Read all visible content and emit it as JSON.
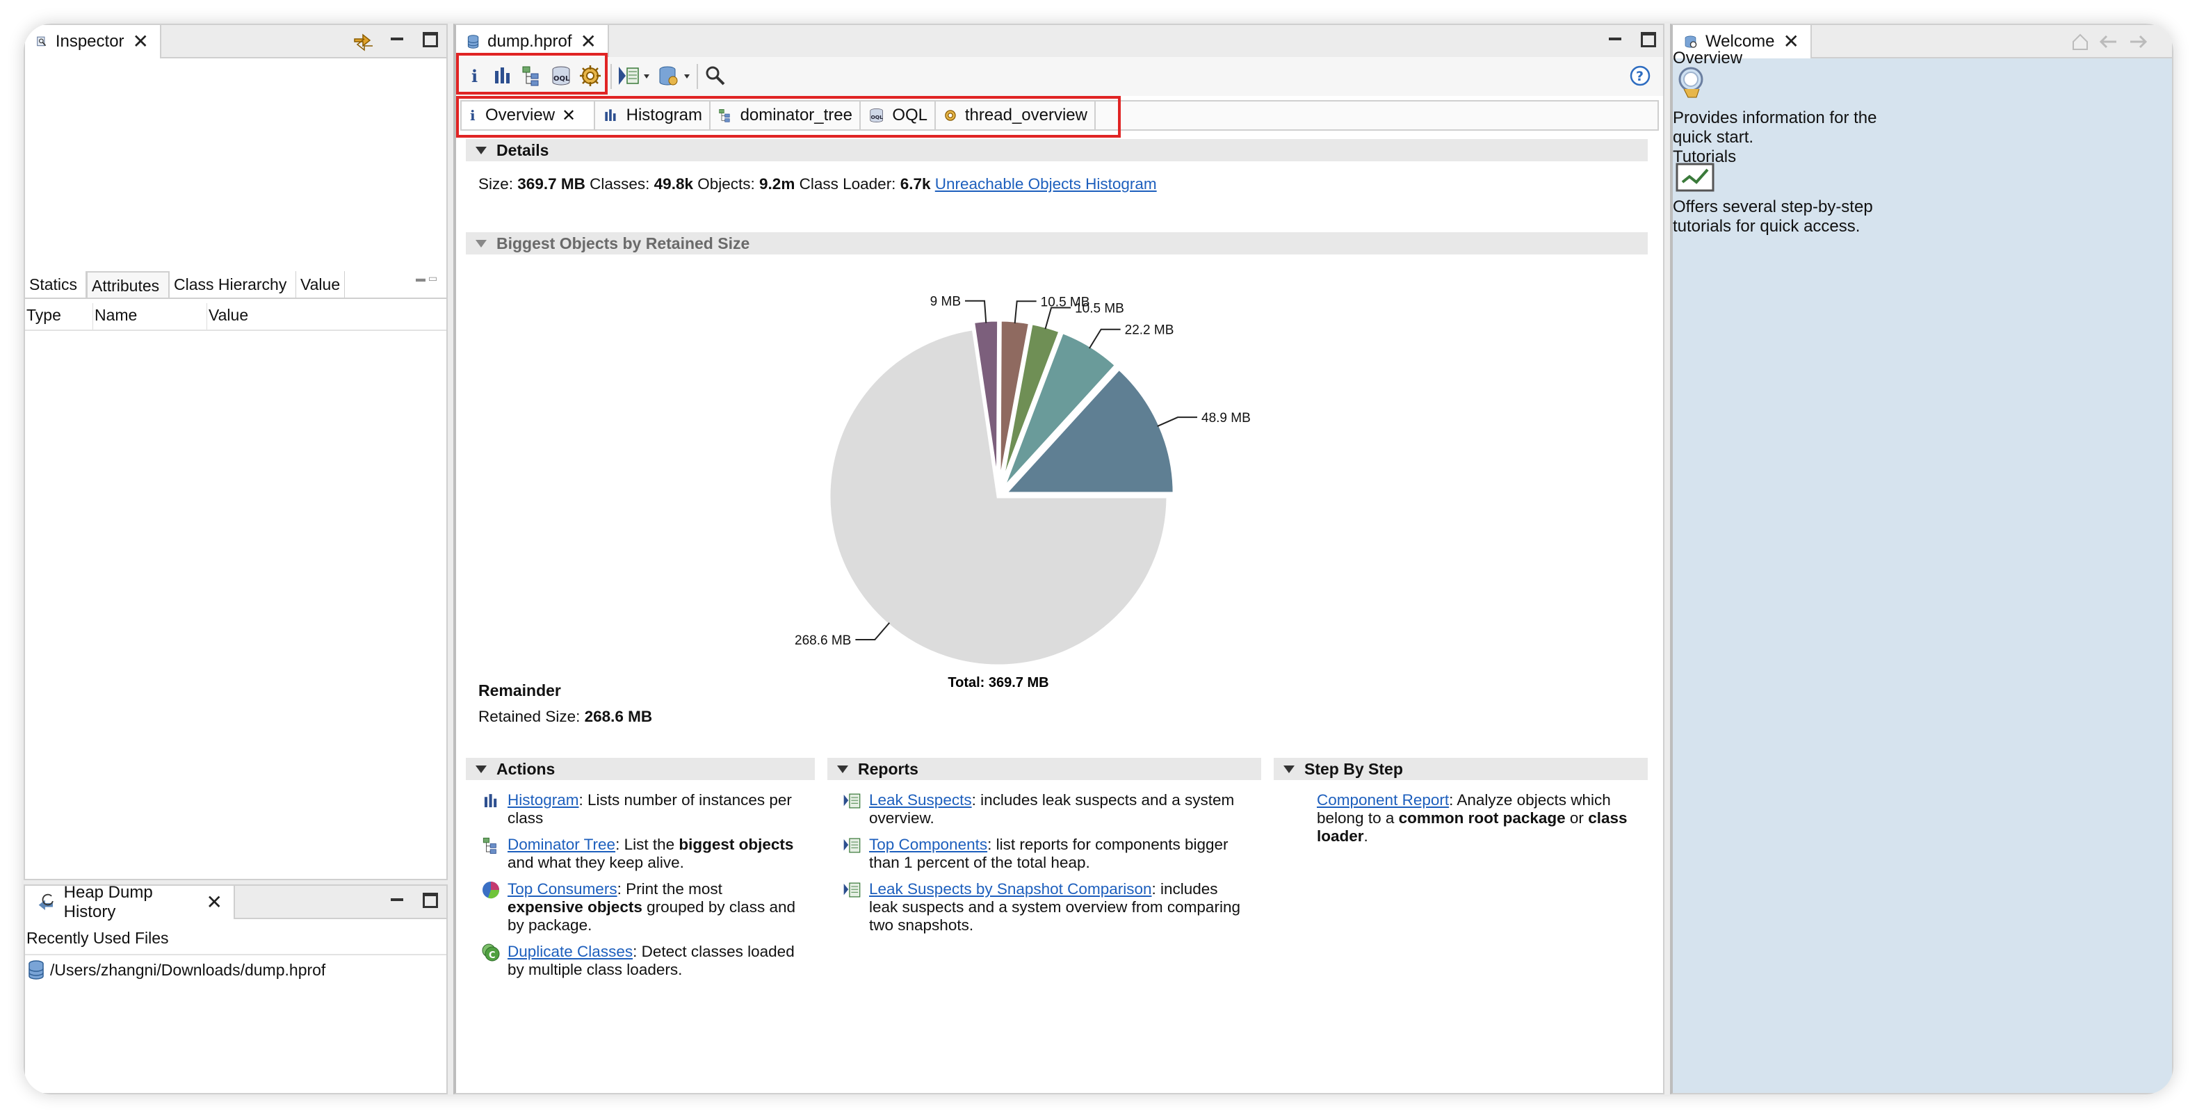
{
  "inspector": {
    "title": "Inspector",
    "subtabs": [
      "Statics",
      "Attributes",
      "Class Hierarchy",
      "Value"
    ],
    "columns": [
      "Type",
      "Name",
      "Value"
    ]
  },
  "history": {
    "title": "Heap Dump History",
    "section": "Recently Used Files",
    "file": "/Users/zhangni/Downloads/dump.hprof"
  },
  "editor": {
    "tab_title": "dump.hprof",
    "inner_tabs": [
      "Overview",
      "Histogram",
      "dominator_tree",
      "OQL",
      "thread_overview"
    ]
  },
  "details": {
    "heading": "Details",
    "size_label": "Size:",
    "size_value": "369.7 MB",
    "classes_label": "Classes:",
    "classes_value": "49.8k",
    "objects_label": "Objects:",
    "objects_value": "9.2m",
    "loader_label": "Class Loader:",
    "loader_value": "6.7k",
    "unreachable_link": "Unreachable Objects Histogram"
  },
  "biggest": {
    "heading": "Biggest Objects by Retained Size",
    "total": "Total: 369.7 MB",
    "remainder_title": "Remainder",
    "retained_label": "Retained Size:",
    "retained_value": "268.6 MB"
  },
  "chart_data": {
    "type": "pie",
    "unit": "MB",
    "slices": [
      {
        "label": "48.9 MB",
        "value": 48.9,
        "color": "#5f7f93"
      },
      {
        "label": "22.2 MB",
        "value": 22.2,
        "color": "#6a9b9a"
      },
      {
        "label": "10.5 MB",
        "value": 10.5,
        "color": "#6f8f55"
      },
      {
        "label": "10.5 MB",
        "value": 10.5,
        "color": "#8f6a60"
      },
      {
        "label": "9 MB",
        "value": 9.0,
        "color": "#7c5f7c"
      },
      {
        "label": "268.6 MB",
        "value": 268.6,
        "color": "#dcdcdc"
      }
    ],
    "total": 369.7
  },
  "actions": {
    "heading": "Actions",
    "histogram_link": "Histogram",
    "histogram_text": ": Lists number of instances per class",
    "dominator_link": "Dominator Tree",
    "dominator_text1": ": List the ",
    "dominator_bold": "biggest objects",
    "dominator_text2": " and what they keep alive.",
    "consumers_link": "Top Consumers",
    "consumers_text1": ": Print the most ",
    "consumers_bold": "expensive objects",
    "consumers_text2": " grouped by class and by package.",
    "duplicate_link": "Duplicate Classes",
    "duplicate_text": ": Detect classes loaded by multiple class loaders."
  },
  "reports": {
    "heading": "Reports",
    "leak_link": "Leak Suspects",
    "leak_text": ": includes leak suspects and a system overview.",
    "top_link": "Top Components",
    "top_text": ": list reports for components bigger than 1 percent of the total heap.",
    "snapshot_link": "Leak Suspects by Snapshot Comparison",
    "snapshot_text": ": includes leak suspects and a system overview from comparing two snapshots."
  },
  "stepbystep": {
    "heading": "Step By Step",
    "component_link": "Component Report",
    "component_text1": ": Analyze objects which belong to a ",
    "component_bold1": "common root package",
    "component_text2": " or ",
    "component_bold2": "class loader",
    "component_text3": "."
  },
  "welcome": {
    "title": "Welcome",
    "overview_label": "Overview",
    "overview_text": "Provides information for the quick start.",
    "tutorials_label": "Tutorials",
    "tutorials_text": "Offers several step-by-step tutorials for quick access."
  }
}
